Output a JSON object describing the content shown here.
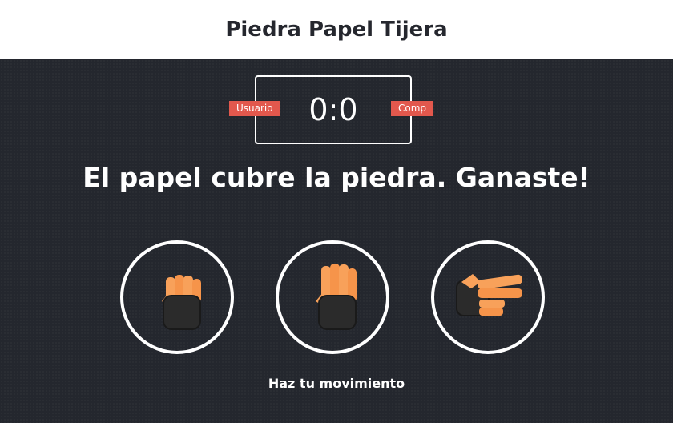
{
  "header": {
    "title": "Piedra Papel Tijera"
  },
  "scoreboard": {
    "user_label": "Usuario",
    "comp_label": "Comp",
    "score": "0:0"
  },
  "result": {
    "message": "El papel cubre la piedra. Ganaste!"
  },
  "choices": [
    {
      "name": "rock",
      "icon": "rock-hand-icon"
    },
    {
      "name": "paper",
      "icon": "paper-hand-icon"
    },
    {
      "name": "scissors",
      "icon": "scissors-hand-icon"
    }
  ],
  "prompt": {
    "text": "Haz tu movimiento"
  },
  "colors": {
    "background": "#24272e",
    "header_bg": "#ffffff",
    "accent": "#e2584d",
    "hand": "#f8a15a",
    "hand_shadow": "#2b2b2b"
  }
}
